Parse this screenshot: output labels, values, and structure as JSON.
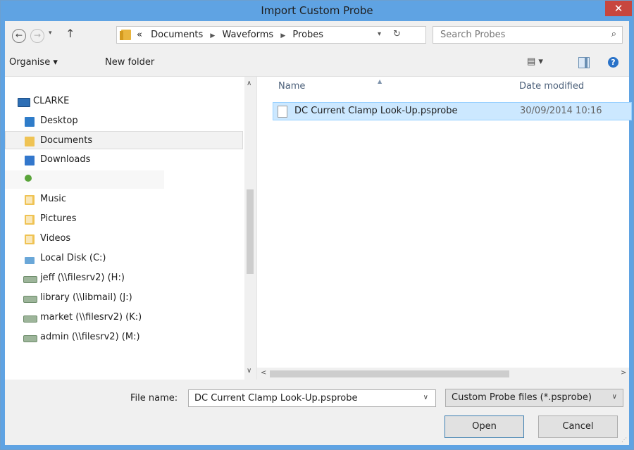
{
  "window": {
    "title": "Import Custom Probe",
    "close_glyph": "✕"
  },
  "address": {
    "back_glyph": "←",
    "forward_glyph": "→",
    "recent_glyph": "▾",
    "up_glyph": "↑",
    "overflow": "«",
    "breadcrumb": [
      "Documents",
      "Waveforms",
      "Probes"
    ],
    "sep_glyph": "▶",
    "dropdown_glyph": "▾",
    "refresh_glyph": "↻"
  },
  "search": {
    "placeholder": "Search Probes",
    "icon": "search-icon",
    "glyph": "⌕"
  },
  "toolbar": {
    "organise": "Organise ▾",
    "new_folder": "New folder",
    "views_glyph": "▤ ▾",
    "help_glyph": "?"
  },
  "nav": {
    "items": [
      {
        "label": "CLARKE",
        "icon": "computer-icon"
      },
      {
        "label": "Desktop",
        "icon": "desktop-folder-icon"
      },
      {
        "label": "Documents",
        "icon": "documents-folder-icon",
        "selected": true
      },
      {
        "label": "Downloads",
        "icon": "downloads-folder-icon"
      },
      {
        "label": "",
        "icon": "network-icon"
      },
      {
        "label": "Music",
        "icon": "music-folder-icon"
      },
      {
        "label": "Pictures",
        "icon": "pictures-folder-icon"
      },
      {
        "label": "Videos",
        "icon": "videos-folder-icon"
      },
      {
        "label": "Local Disk (C:)",
        "icon": "local-disk-icon"
      },
      {
        "label": "jeff (\\\\filesrv2) (H:)",
        "icon": "network-drive-icon"
      },
      {
        "label": "library (\\\\libmail) (J:)",
        "icon": "network-drive-icon"
      },
      {
        "label": "market (\\\\filesrv2) (K:)",
        "icon": "network-drive-icon"
      },
      {
        "label": "admin (\\\\filesrv2) (M:)",
        "icon": "network-drive-icon"
      }
    ],
    "scroll_up_glyph": "∧",
    "scroll_down_glyph": "∨"
  },
  "list": {
    "columns": [
      "Name",
      "Date modified"
    ],
    "sort_glyph": "▲",
    "files": [
      {
        "name": "DC Current Clamp Look-Up.psprobe",
        "date_modified": "30/09/2014 10:16",
        "selected": true
      }
    ],
    "scroll_left_glyph": "<",
    "scroll_right_glyph": ">"
  },
  "footer": {
    "file_name_label": "File name:",
    "file_name_value": "DC Current Clamp Look-Up.psprobe",
    "file_type": "Custom Probe files (*.psprobe)",
    "dropdown_glyph": "∨",
    "open_label": "Open",
    "cancel_label": "Cancel",
    "grip_glyph": "⋰"
  }
}
